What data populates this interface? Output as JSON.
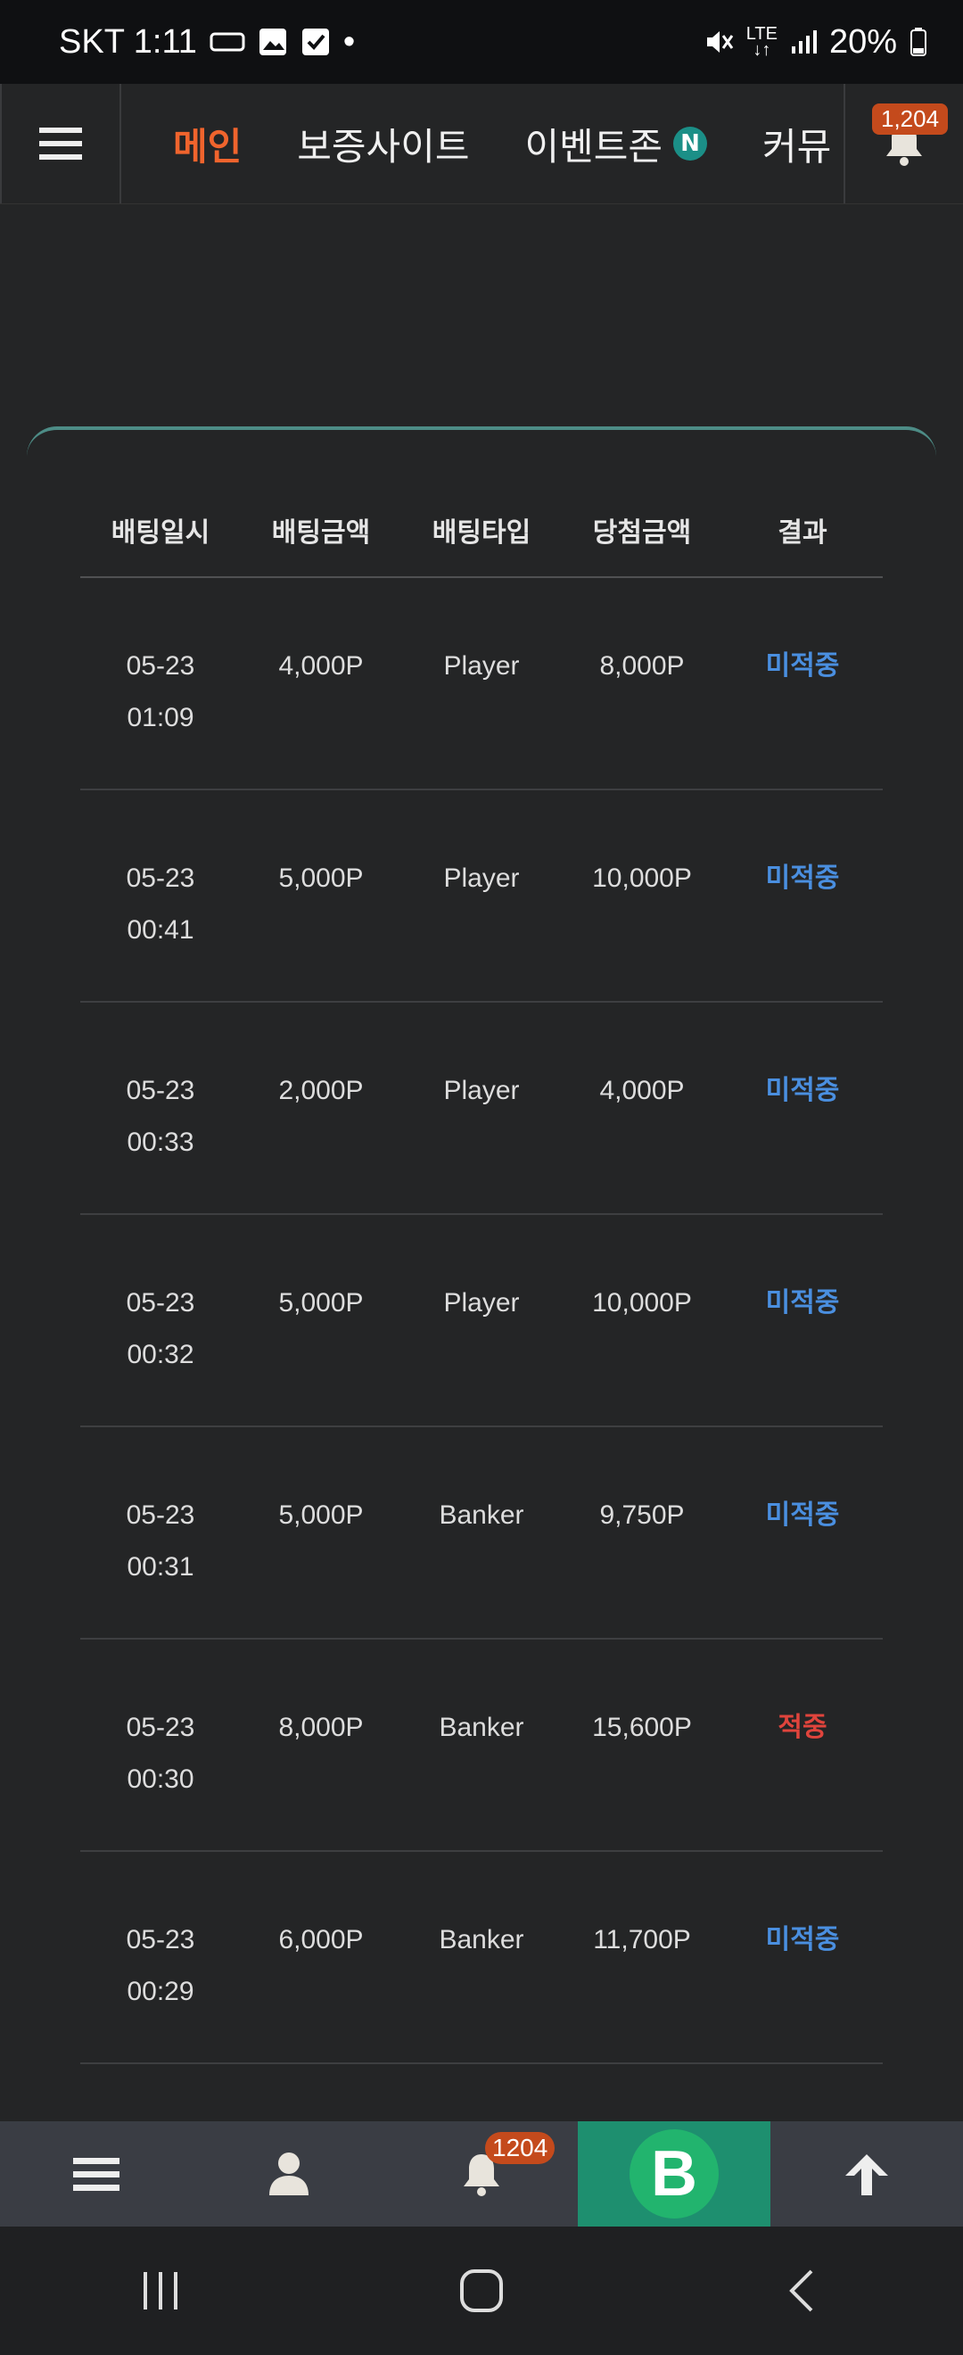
{
  "status_bar": {
    "carrier_time": "SKT 1:11",
    "battery": "20%",
    "network": "LTE"
  },
  "top_nav": {
    "items": [
      {
        "label": "메인",
        "active": true
      },
      {
        "label": "보증사이트"
      },
      {
        "label": "이벤트존",
        "badge": "N"
      },
      {
        "label": "커뮤"
      }
    ],
    "bell_count": "1,204"
  },
  "table": {
    "headers": [
      "배팅일시",
      "배팅금액",
      "배팅타입",
      "당첨금액",
      "결과"
    ],
    "rows": [
      {
        "date": "05-23",
        "time": "01:09",
        "amount": "4,000P",
        "type": "Player",
        "win": "8,000P",
        "result": "미적중"
      },
      {
        "date": "05-23",
        "time": "00:41",
        "amount": "5,000P",
        "type": "Player",
        "win": "10,000P",
        "result": "미적중"
      },
      {
        "date": "05-23",
        "time": "00:33",
        "amount": "2,000P",
        "type": "Player",
        "win": "4,000P",
        "result": "미적중"
      },
      {
        "date": "05-23",
        "time": "00:32",
        "amount": "5,000P",
        "type": "Player",
        "win": "10,000P",
        "result": "미적중"
      },
      {
        "date": "05-23",
        "time": "00:31",
        "amount": "5,000P",
        "type": "Banker",
        "win": "9,750P",
        "result": "미적중"
      },
      {
        "date": "05-23",
        "time": "00:30",
        "amount": "8,000P",
        "type": "Banker",
        "win": "15,600P",
        "result": "적중"
      },
      {
        "date": "05-23",
        "time": "00:29",
        "amount": "6,000P",
        "type": "Banker",
        "win": "11,700P",
        "result": "미적중"
      }
    ]
  },
  "bottom_bar": {
    "notification_count": "1204",
    "brand_letter": "B"
  },
  "colors": {
    "accent": "#f0642d",
    "miss": "#4a8fe0",
    "hit": "#e0443c",
    "teal": "#4d8c86"
  }
}
